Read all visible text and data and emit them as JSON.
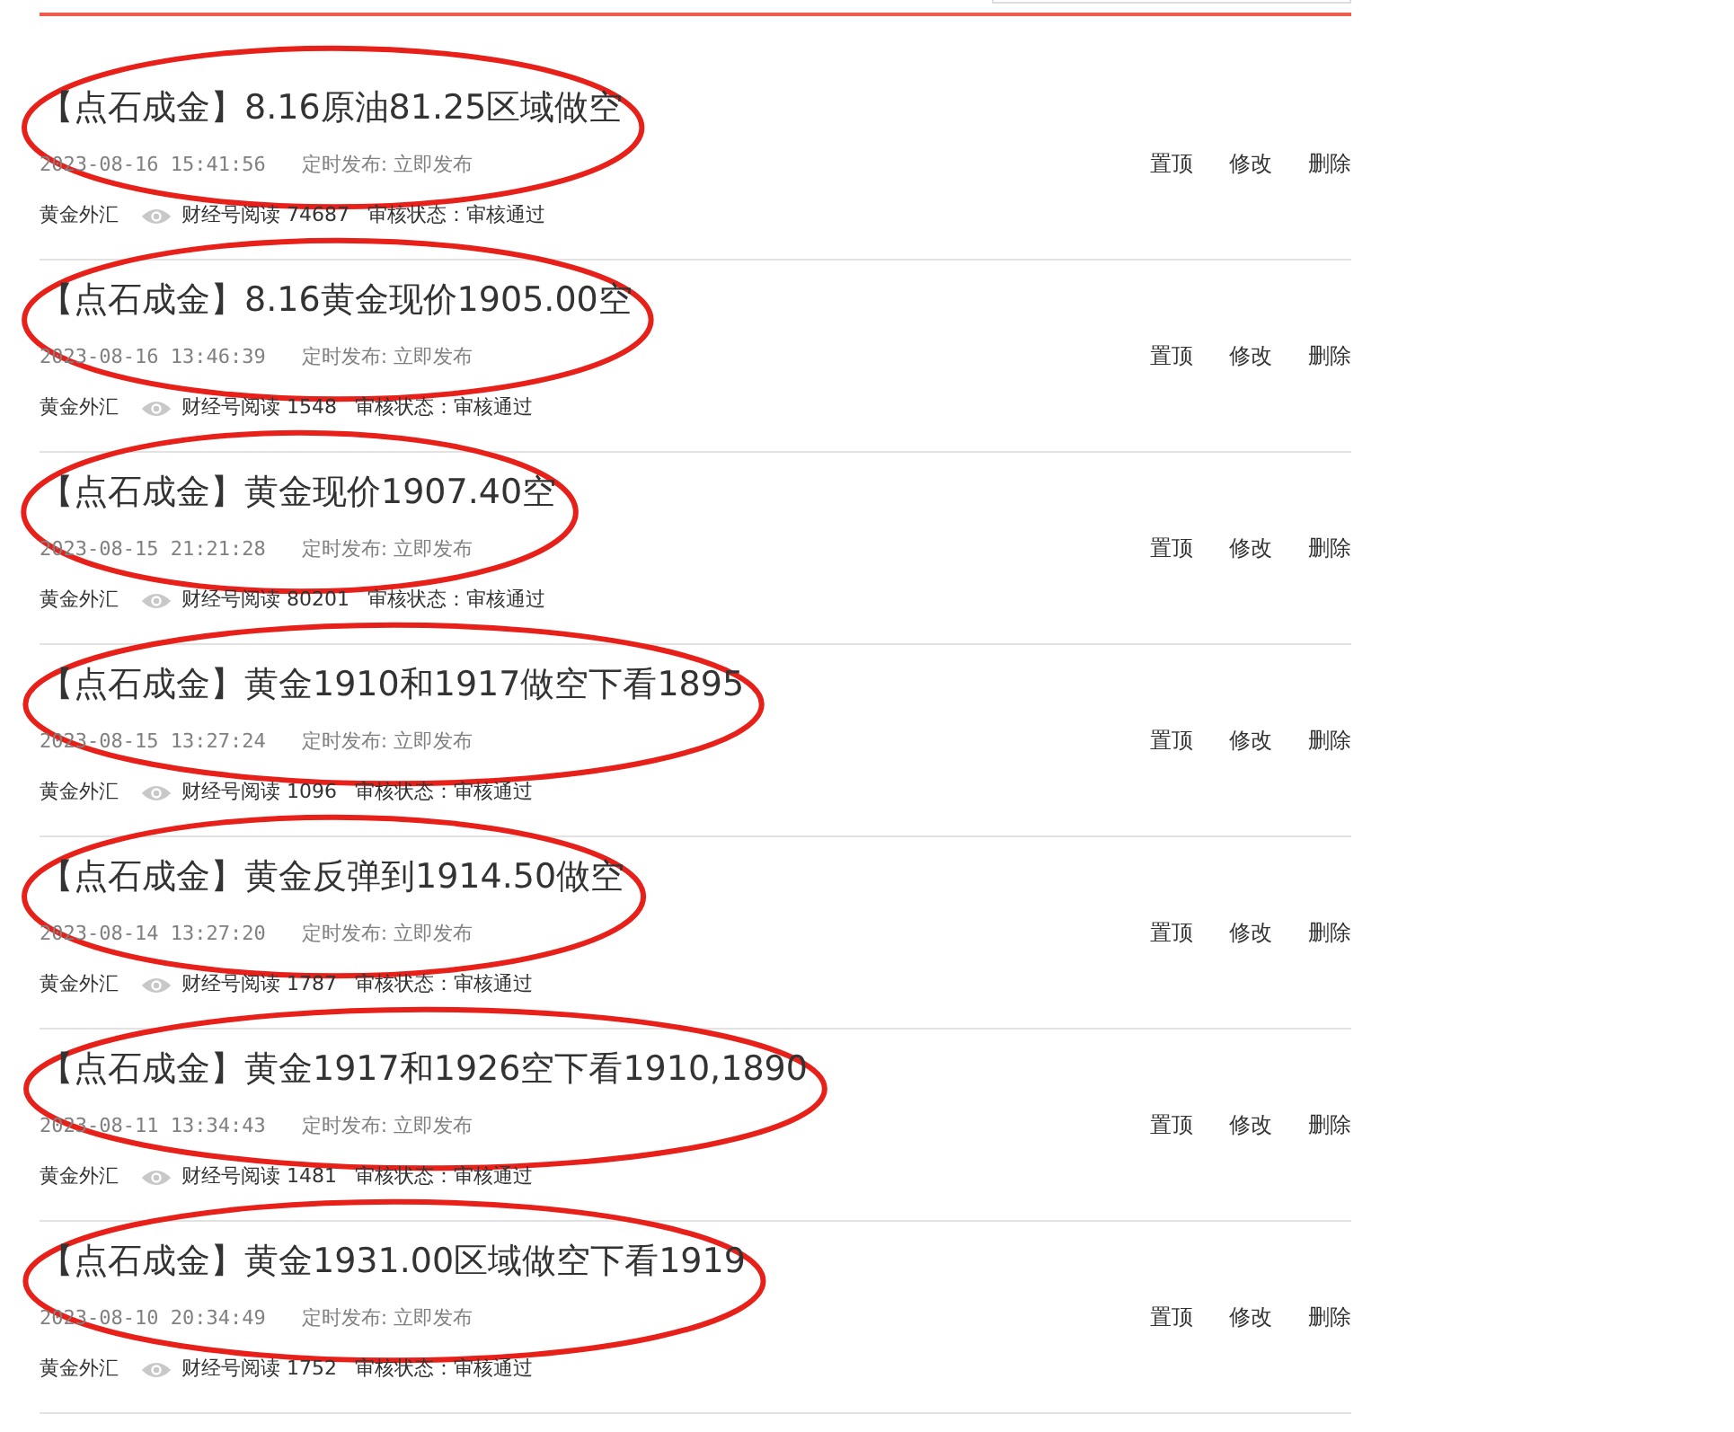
{
  "search": {
    "kind": "field"
  },
  "articles": [
    {
      "title": "【点石成金】8.16原油81.25区域做空",
      "time": "2023-08-16 15:41:56",
      "schedule": "定时发布: 立即发布",
      "category": "黄金外汇",
      "reads": "财经号阅读 74687",
      "review": "审核状态：审核通过",
      "circled": true,
      "actions": [
        "置顶",
        "修改",
        "删除"
      ]
    },
    {
      "title": "【点石成金】8.16黄金现价1905.00空",
      "time": "2023-08-16 13:46:39",
      "schedule": "定时发布: 立即发布",
      "category": "黄金外汇",
      "reads": "财经号阅读 1548",
      "review": "审核状态：审核通过",
      "circled": true,
      "actions": [
        "置顶",
        "修改",
        "删除"
      ]
    },
    {
      "title": "【点石成金】黄金现价1907.40空",
      "time": "2023-08-15 21:21:28",
      "schedule": "定时发布: 立即发布",
      "category": "黄金外汇",
      "reads": "财经号阅读 80201",
      "review": "审核状态：审核通过",
      "circled": true,
      "actions": [
        "置顶",
        "修改",
        "删除"
      ]
    },
    {
      "title": "【点石成金】黄金1910和1917做空下看1895",
      "time": "2023-08-15 13:27:24",
      "schedule": "定时发布: 立即发布",
      "category": "黄金外汇",
      "reads": "财经号阅读 1096",
      "review": "审核状态：审核通过",
      "circled": true,
      "actions": [
        "置顶",
        "修改",
        "删除"
      ]
    },
    {
      "title": "【点石成金】黄金反弹到1914.50做空",
      "time": "2023-08-14 13:27:20",
      "schedule": "定时发布: 立即发布",
      "category": "黄金外汇",
      "reads": "财经号阅读 1787",
      "review": "审核状态：审核通过",
      "circled": true,
      "actions": [
        "置顶",
        "修改",
        "删除"
      ]
    },
    {
      "title": "【点石成金】黄金1917和1926空下看1910,1890",
      "time": "2023-08-11 13:34:43",
      "schedule": "定时发布: 立即发布",
      "category": "黄金外汇",
      "reads": "财经号阅读 1481",
      "review": "审核状态：审核通过",
      "circled": true,
      "actions": [
        "置顶",
        "修改",
        "删除"
      ]
    },
    {
      "title": "【点石成金】黄金1931.00区域做空下看1919",
      "time": "2023-08-10 20:34:49",
      "schedule": "定时发布: 立即发布",
      "category": "黄金外汇",
      "reads": "财经号阅读 1752",
      "review": "审核状态：审核通过",
      "circled": true,
      "actions": [
        "置顶",
        "修改",
        "删除"
      ]
    }
  ]
}
